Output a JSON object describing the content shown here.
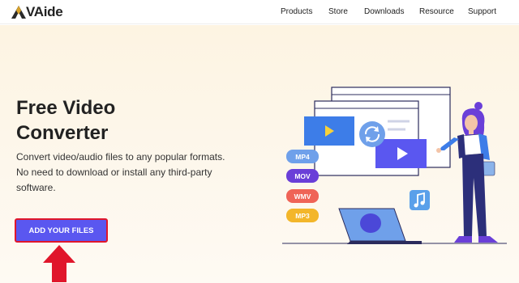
{
  "header": {
    "logo_text": "VAide",
    "nav": [
      "Products",
      "Store",
      "Downloads",
      "Resource",
      "Support"
    ]
  },
  "hero": {
    "title_line1": "Free Video",
    "title_line2": "Converter",
    "description": "Convert video/audio files to any popular formats. No need to download or install any third-party software.",
    "button_label": "ADD YOUR FILES"
  },
  "illustration": {
    "formats": [
      "MP4",
      "MOV",
      "WMV",
      "MP3"
    ]
  },
  "colors": {
    "accent": "#5a57f0",
    "highlight_red": "#e0162b",
    "hero_bg": "#fdf5e6"
  }
}
